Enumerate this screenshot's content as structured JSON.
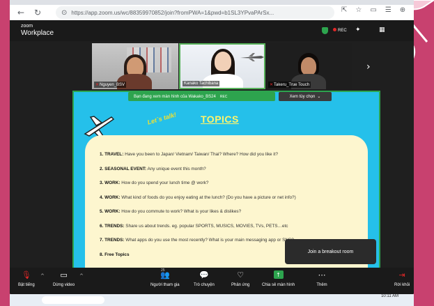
{
  "browser": {
    "url": "https://app.zoom.us/wc/88359970852/join?fromPWA=1&pwd=b1SL3YPvaPArSx...",
    "search_placeholder": ""
  },
  "zoom": {
    "logo_small": "zoom",
    "logo": "Workplace",
    "rec_label": "REC"
  },
  "participants": [
    {
      "name": "Nguyen_BSV"
    },
    {
      "name": "Kanako Tachibana"
    },
    {
      "name": "Takeru_True Touch"
    }
  ],
  "share_banner": {
    "text": "Bạn đang xem màn hình của  Wakako_BS24",
    "rec": "REC",
    "view_options": "Xem tùy chọn"
  },
  "slide": {
    "title": "TOPICS",
    "lets_talk": "Let`s talk!",
    "topics": [
      {
        "num": "1.",
        "label": "TRAVEL:",
        "text": " Have you been to Japan/ Vietnam/ Taiwan/ Thai? Where? How did you like it?"
      },
      {
        "num": "2.",
        "label": "SEASONAL EVENT:",
        "text": " Any unique event this month?"
      },
      {
        "num": "3.",
        "label": "WORK:",
        "text": " How do you spend your lunch time @ work?"
      },
      {
        "num": "4.",
        "label": "WORK:",
        "text": " What kind of foods do you enjoy eating at the lunch? (Do you have a picture or net info?)"
      },
      {
        "num": "5.",
        "label": "WORK:",
        "text": " How do you commute to work? What is your likes & dislikes?"
      },
      {
        "num": "6.",
        "label": "TRENDS:",
        "text": " Share us about trends. eg. popular SPORTS, MUSICS, MOVIES, TVs, PETS…etc"
      },
      {
        "num": "7.",
        "label": "TRENDS:",
        "text": " What apps do you use the most recently? What is your main messaging app or SNS?"
      },
      {
        "num": "8.",
        "label": "Free Topics",
        "text": ""
      }
    ]
  },
  "breakout_label": "Join a breakout room",
  "toolbar": {
    "mute": "Bật tiếng",
    "video": "Dừng video",
    "participants": "Người tham gia",
    "participants_count": "25",
    "chat": "Trò chuyện",
    "reactions": "Phản ứng",
    "share": "Chia sẻ màn hình",
    "more": "Thêm",
    "leave": "Rời khỏi"
  },
  "taskbar": {
    "time": "10:11 AM"
  }
}
